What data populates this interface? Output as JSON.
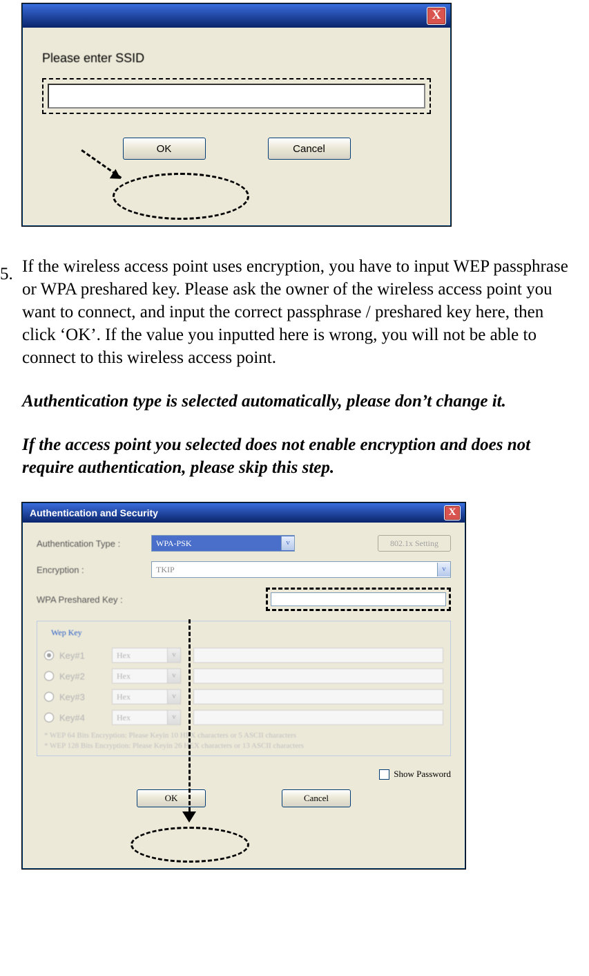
{
  "list_number": "5.",
  "dialog1": {
    "prompt_label": "Please enter SSID",
    "ok_label": "OK",
    "cancel_label": "Cancel",
    "close_glyph": "X"
  },
  "paragraph": "If the wireless access point uses encryption, you have to input WEP passphrase or WPA preshared key. Please ask the owner of the wireless access point you want to connect, and input the correct passphrase / preshared key here, then click ‘OK’. If the value you inputted here is wrong, you will not be able to connect to this wireless access point.",
  "note1": "Authentication type is selected automatically, please don’t change it.",
  "note2": "If the access point you selected does not enable encryption and does not require authentication, please skip this step.",
  "dialog2": {
    "title": "Authentication and Security",
    "close_glyph": "X",
    "auth_type_label": "Authentication Type :",
    "auth_type_value": "WPA-PSK",
    "btn_8021x": "802.1x Setting",
    "encryption_label": "Encryption :",
    "encryption_value": "TKIP",
    "psk_label": "WPA Preshared Key :",
    "wep_legend": "Wep Key",
    "wep_rows": [
      {
        "label": "Key#1",
        "fmt": "Hex",
        "selected": true
      },
      {
        "label": "Key#2",
        "fmt": "Hex",
        "selected": false
      },
      {
        "label": "Key#3",
        "fmt": "Hex",
        "selected": false
      },
      {
        "label": "Key#4",
        "fmt": "Hex",
        "selected": false
      }
    ],
    "hint1": "* WEP 64 Bits Encryption: Please Keyin 10 HEX characters or 5 ASCII characters",
    "hint2": "* WEP 128 Bits Encryption: Please Keyin 26 HEX characters or 13 ASCII characters",
    "show_password_label": "Show Password",
    "ok_label": "OK",
    "cancel_label": "Cancel",
    "dd_glyph": "v"
  }
}
